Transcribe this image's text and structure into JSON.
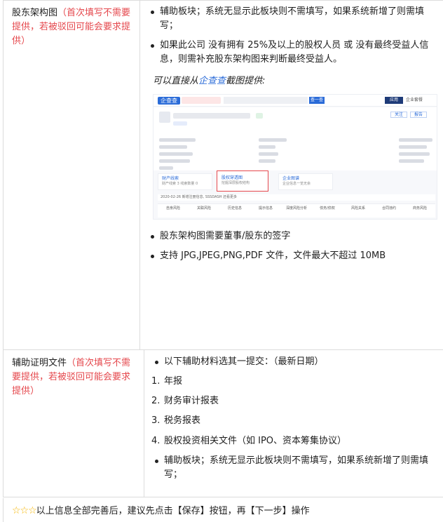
{
  "rows": [
    {
      "label": "股东架构图",
      "note": "（首次填写不需要提供，若被驳回可能会要求提供）",
      "items1": [
        "辅助板块；系统无显示此板块则不需填写，如果系统新增了则需填写；",
        "如果此公司 没有拥有 25%及以上的股权人员 或 没有最终受益人信息，则需补充股东架构图来判断最终受益人。"
      ],
      "intro_pre": "可以直接从",
      "intro_link": "企查查",
      "intro_post": "截图提供:",
      "items2": [
        "股东架构图需要董事/股东的签字",
        "支持 JPG,JPEG,PNG,PDF 文件，文件最大不超过 10MB"
      ]
    },
    {
      "label": "辅助证明文件",
      "note": "（首次填写不需要提供，若被驳回可能会要求提供）",
      "lead": "以下辅助材料选其一提交：（最新日期）",
      "numbered": [
        {
          "n": "1.",
          "t": "年报"
        },
        {
          "n": "2.",
          "t": "财务审计报表"
        },
        {
          "n": "3.",
          "t": "税务报表"
        },
        {
          "n": "4.",
          "t": "股权投资相关文件（如 IPO、资本筹集协议）"
        }
      ],
      "tail": "辅助板块；系统无显示此板块则不需填写，如果系统新增了则需填写；"
    }
  ],
  "footer": {
    "stars": "☆☆☆",
    "text": "以上信息全部完善后，建议先点击【保存】按钮，再【下一步】操作"
  },
  "screenshot": {
    "logo": "企查查",
    "search_btn": "查一查",
    "tag_app": "应用",
    "tag_enterprise": "企业套餐",
    "btn_follow": "关注",
    "btn_report": "报告",
    "card1_title": "财产线索",
    "card1_sub": "财产线索 3  线索数量 0",
    "card2_title": "股权穿透图",
    "card2_sub": "挖掘深层股权结构",
    "card3_title": "企业图谱",
    "card3_sub": "企业信息一览无余",
    "update_text": "2020-02-26 新增注册信息, SSSDASH 还看更多",
    "tabs": [
      "自身风险",
      "关联风险",
      "历史信息",
      "提示信息",
      "深度风险分析",
      "债务/债权",
      "风险关系",
      "合同违约",
      "商务风险"
    ],
    "accent": "#2a6bd8",
    "highlight": "#e5484d"
  }
}
